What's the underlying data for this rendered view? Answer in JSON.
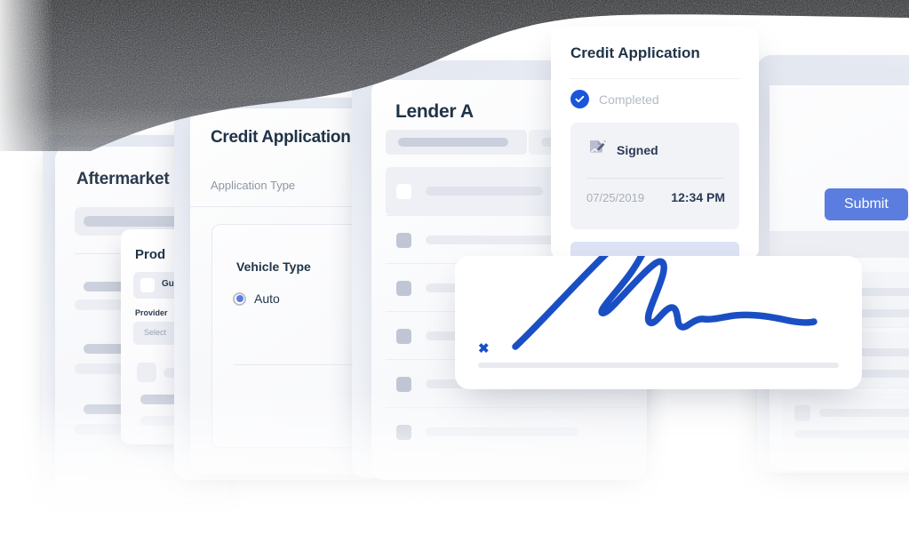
{
  "cards": {
    "aftermarket": {
      "title": "Aftermarket"
    },
    "products": {
      "title": "Prod",
      "checkbox_label": "Gu",
      "provider_label": "Provider",
      "select_placeholder": "Select"
    },
    "credit_form": {
      "title": "Credit Application",
      "subtitle": "Application Type",
      "panel_title": "Vehicle Type",
      "radio_label": "Auto"
    },
    "lender": {
      "title": "Lender A"
    },
    "right": {
      "submit_label": "Submit"
    },
    "status": {
      "title": "Credit Application",
      "completed_label": "Completed",
      "signed_label": "Signed",
      "date": "07/25/2019",
      "time": "12:34 PM"
    },
    "signature": {
      "x_mark": "✖"
    }
  },
  "colors": {
    "accent_blue": "#5b7de0",
    "signature_blue": "#1a4fc4",
    "check_blue": "#1a56db",
    "heading_navy": "#1f3347",
    "muted_gray": "#b3bac6",
    "panel_gray": "#f2f3f7",
    "skeleton_gray": "#e4e7ee"
  },
  "icons": {
    "check": "check-icon",
    "signature": "signature-pen-icon",
    "x_mark": "x-mark-icon"
  }
}
